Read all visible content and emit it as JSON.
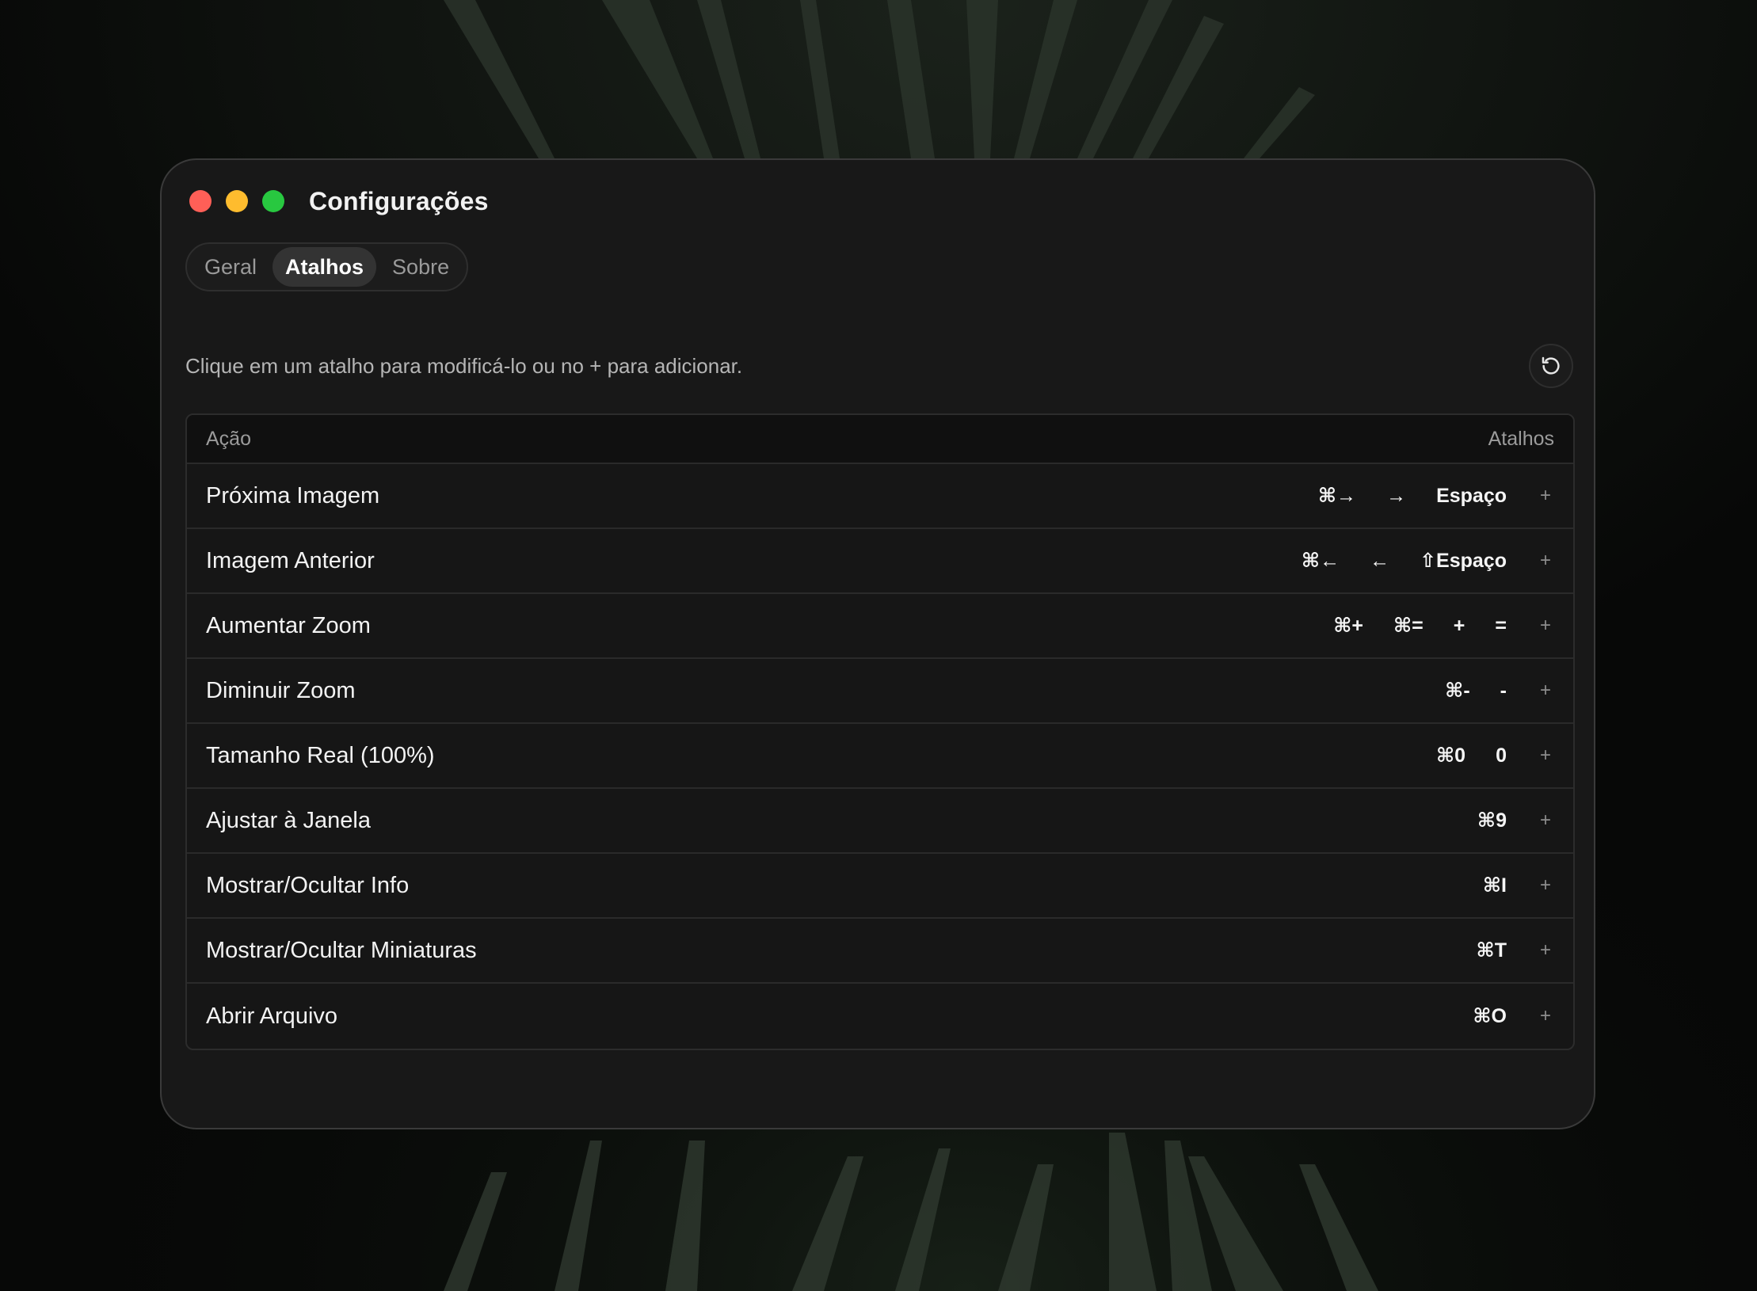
{
  "window": {
    "title": "Configurações"
  },
  "tabs": [
    {
      "label": "Geral",
      "active": false
    },
    {
      "label": "Atalhos",
      "active": true
    },
    {
      "label": "Sobre",
      "active": false
    }
  ],
  "hint": "Clique em um atalho para modificá-lo ou no + para adicionar.",
  "reset_icon": "reset-icon",
  "table": {
    "headers": {
      "action": "Ação",
      "shortcuts": "Atalhos"
    },
    "add_label": "+",
    "rows": [
      {
        "action": "Próxima Imagem",
        "keys": [
          "⌘→",
          "→",
          "Espaço"
        ]
      },
      {
        "action": "Imagem Anterior",
        "keys": [
          "⌘←",
          "←",
          "⇧Espaço"
        ]
      },
      {
        "action": "Aumentar Zoom",
        "keys": [
          "⌘+",
          "⌘=",
          "+",
          "="
        ]
      },
      {
        "action": "Diminuir Zoom",
        "keys": [
          "⌘-",
          "-"
        ]
      },
      {
        "action": "Tamanho Real (100%)",
        "keys": [
          "⌘0",
          "0"
        ]
      },
      {
        "action": "Ajustar à Janela",
        "keys": [
          "⌘9"
        ]
      },
      {
        "action": "Mostrar/Ocultar Info",
        "keys": [
          "⌘I"
        ]
      },
      {
        "action": "Mostrar/Ocultar Miniaturas",
        "keys": [
          "⌘T"
        ]
      },
      {
        "action": "Abrir Arquivo",
        "keys": [
          "⌘O"
        ]
      }
    ]
  },
  "colors": {
    "close": "#ff5f57",
    "minimize": "#febc2e",
    "zoom": "#28c840",
    "window_bg": "#181818"
  }
}
